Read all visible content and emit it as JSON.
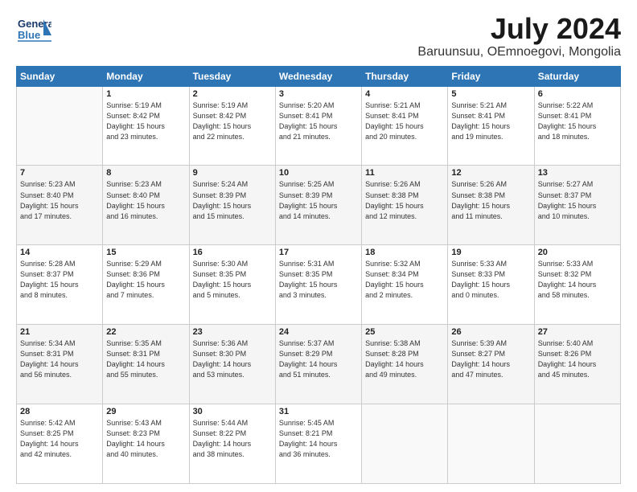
{
  "header": {
    "logo_general": "General",
    "logo_blue": "Blue",
    "main_title": "July 2024",
    "subtitle": "Baruunsuu, OEmnoegovi, Mongolia"
  },
  "calendar": {
    "days_of_week": [
      "Sunday",
      "Monday",
      "Tuesday",
      "Wednesday",
      "Thursday",
      "Friday",
      "Saturday"
    ],
    "weeks": [
      [
        {
          "day": "",
          "detail": ""
        },
        {
          "day": "1",
          "detail": "Sunrise: 5:19 AM\nSunset: 8:42 PM\nDaylight: 15 hours\nand 23 minutes."
        },
        {
          "day": "2",
          "detail": "Sunrise: 5:19 AM\nSunset: 8:42 PM\nDaylight: 15 hours\nand 22 minutes."
        },
        {
          "day": "3",
          "detail": "Sunrise: 5:20 AM\nSunset: 8:41 PM\nDaylight: 15 hours\nand 21 minutes."
        },
        {
          "day": "4",
          "detail": "Sunrise: 5:21 AM\nSunset: 8:41 PM\nDaylight: 15 hours\nand 20 minutes."
        },
        {
          "day": "5",
          "detail": "Sunrise: 5:21 AM\nSunset: 8:41 PM\nDaylight: 15 hours\nand 19 minutes."
        },
        {
          "day": "6",
          "detail": "Sunrise: 5:22 AM\nSunset: 8:41 PM\nDaylight: 15 hours\nand 18 minutes."
        }
      ],
      [
        {
          "day": "7",
          "detail": "Sunrise: 5:23 AM\nSunset: 8:40 PM\nDaylight: 15 hours\nand 17 minutes."
        },
        {
          "day": "8",
          "detail": "Sunrise: 5:23 AM\nSunset: 8:40 PM\nDaylight: 15 hours\nand 16 minutes."
        },
        {
          "day": "9",
          "detail": "Sunrise: 5:24 AM\nSunset: 8:39 PM\nDaylight: 15 hours\nand 15 minutes."
        },
        {
          "day": "10",
          "detail": "Sunrise: 5:25 AM\nSunset: 8:39 PM\nDaylight: 15 hours\nand 14 minutes."
        },
        {
          "day": "11",
          "detail": "Sunrise: 5:26 AM\nSunset: 8:38 PM\nDaylight: 15 hours\nand 12 minutes."
        },
        {
          "day": "12",
          "detail": "Sunrise: 5:26 AM\nSunset: 8:38 PM\nDaylight: 15 hours\nand 11 minutes."
        },
        {
          "day": "13",
          "detail": "Sunrise: 5:27 AM\nSunset: 8:37 PM\nDaylight: 15 hours\nand 10 minutes."
        }
      ],
      [
        {
          "day": "14",
          "detail": "Sunrise: 5:28 AM\nSunset: 8:37 PM\nDaylight: 15 hours\nand 8 minutes."
        },
        {
          "day": "15",
          "detail": "Sunrise: 5:29 AM\nSunset: 8:36 PM\nDaylight: 15 hours\nand 7 minutes."
        },
        {
          "day": "16",
          "detail": "Sunrise: 5:30 AM\nSunset: 8:35 PM\nDaylight: 15 hours\nand 5 minutes."
        },
        {
          "day": "17",
          "detail": "Sunrise: 5:31 AM\nSunset: 8:35 PM\nDaylight: 15 hours\nand 3 minutes."
        },
        {
          "day": "18",
          "detail": "Sunrise: 5:32 AM\nSunset: 8:34 PM\nDaylight: 15 hours\nand 2 minutes."
        },
        {
          "day": "19",
          "detail": "Sunrise: 5:33 AM\nSunset: 8:33 PM\nDaylight: 15 hours\nand 0 minutes."
        },
        {
          "day": "20",
          "detail": "Sunrise: 5:33 AM\nSunset: 8:32 PM\nDaylight: 14 hours\nand 58 minutes."
        }
      ],
      [
        {
          "day": "21",
          "detail": "Sunrise: 5:34 AM\nSunset: 8:31 PM\nDaylight: 14 hours\nand 56 minutes."
        },
        {
          "day": "22",
          "detail": "Sunrise: 5:35 AM\nSunset: 8:31 PM\nDaylight: 14 hours\nand 55 minutes."
        },
        {
          "day": "23",
          "detail": "Sunrise: 5:36 AM\nSunset: 8:30 PM\nDaylight: 14 hours\nand 53 minutes."
        },
        {
          "day": "24",
          "detail": "Sunrise: 5:37 AM\nSunset: 8:29 PM\nDaylight: 14 hours\nand 51 minutes."
        },
        {
          "day": "25",
          "detail": "Sunrise: 5:38 AM\nSunset: 8:28 PM\nDaylight: 14 hours\nand 49 minutes."
        },
        {
          "day": "26",
          "detail": "Sunrise: 5:39 AM\nSunset: 8:27 PM\nDaylight: 14 hours\nand 47 minutes."
        },
        {
          "day": "27",
          "detail": "Sunrise: 5:40 AM\nSunset: 8:26 PM\nDaylight: 14 hours\nand 45 minutes."
        }
      ],
      [
        {
          "day": "28",
          "detail": "Sunrise: 5:42 AM\nSunset: 8:25 PM\nDaylight: 14 hours\nand 42 minutes."
        },
        {
          "day": "29",
          "detail": "Sunrise: 5:43 AM\nSunset: 8:23 PM\nDaylight: 14 hours\nand 40 minutes."
        },
        {
          "day": "30",
          "detail": "Sunrise: 5:44 AM\nSunset: 8:22 PM\nDaylight: 14 hours\nand 38 minutes."
        },
        {
          "day": "31",
          "detail": "Sunrise: 5:45 AM\nSunset: 8:21 PM\nDaylight: 14 hours\nand 36 minutes."
        },
        {
          "day": "",
          "detail": ""
        },
        {
          "day": "",
          "detail": ""
        },
        {
          "day": "",
          "detail": ""
        }
      ]
    ]
  }
}
